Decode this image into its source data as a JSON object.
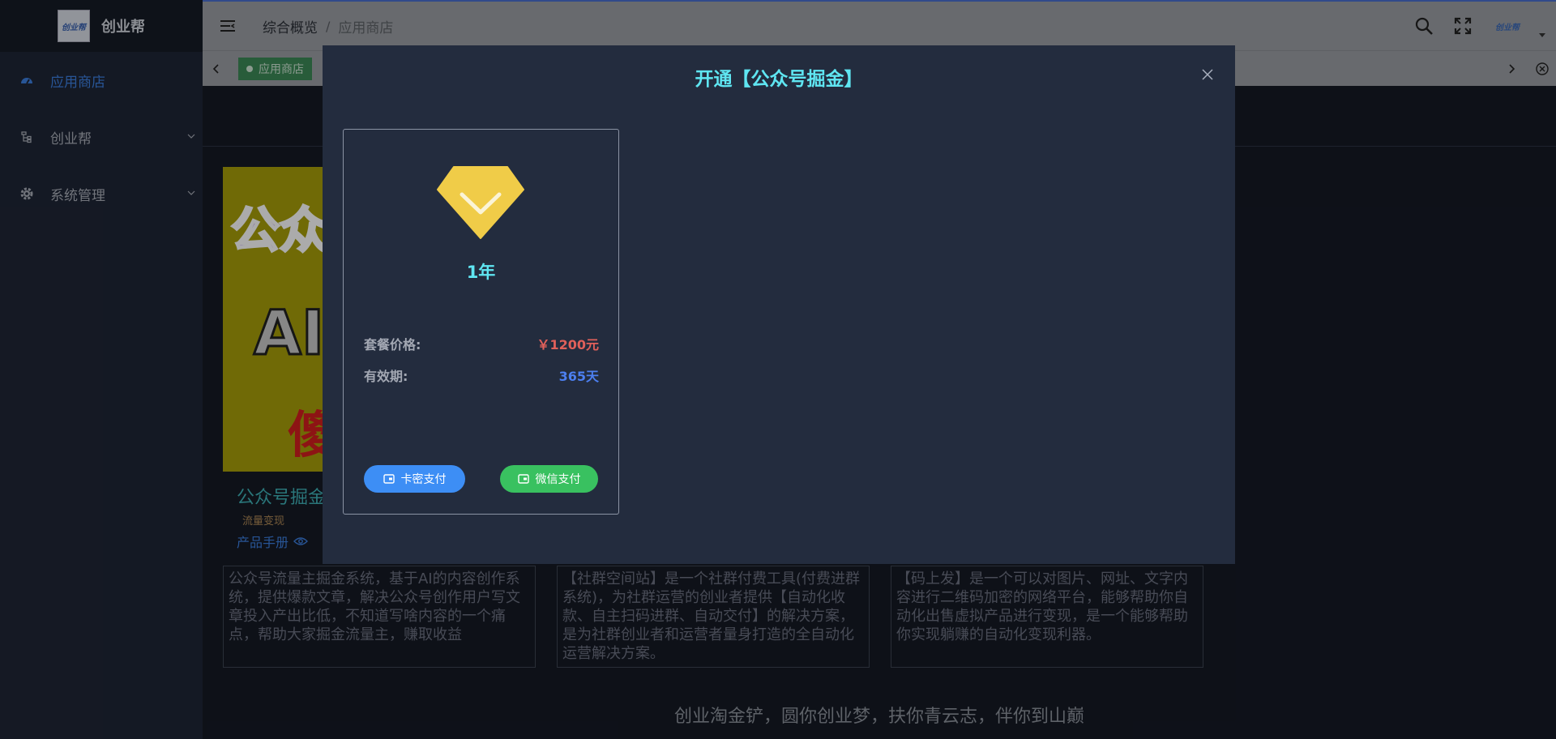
{
  "sidebar": {
    "logo_text": "创业帮",
    "logo_mark": "创业帮",
    "items": [
      {
        "label": "应用商店"
      },
      {
        "label": "创业帮"
      },
      {
        "label": "系统管理"
      }
    ]
  },
  "header": {
    "breadcrumb": [
      "综合概览",
      "应用商店"
    ],
    "separator": "/",
    "avatar_mark": "创业帮"
  },
  "tagbar": {
    "active_tag": "应用商店"
  },
  "content": {
    "card1": {
      "img_line1": "公众号",
      "img_line2": "AI",
      "img_line3": "傻",
      "title": "公众号掘金",
      "tag": "流量变现",
      "manual": "产品手册"
    },
    "descriptions": [
      "公众号流量主掘金系统，基于AI的内容创作系统，提供爆款文章，解决公众号创作用户写文章投入产出比低，不知道写啥内容的一个痛点，帮助大家掘金流量主，赚取收益",
      "【社群空间站】是一个社群付费工具(付费进群系统)，为社群运营的创业者提供【自动化收款、自主扫码进群、自动交付】的解决方案，是为社群创业者和运营者量身打造的全自动化运营解决方案。",
      "【码上发】是一个可以对图片、网址、文字内容进行二维码加密的网络平台，能够帮助你自动化出售虚拟产品进行变现，是一个能够帮助你实现躺赚的自动化变现利器。"
    ],
    "footer": "创业淘金铲，圆你创业梦，扶你青云志，伴你到山巅"
  },
  "modal": {
    "title": "开通【公众号掘金】",
    "plan": {
      "name": "1年",
      "price_label": "套餐价格:",
      "price_value": "￥1200元",
      "validity_label": "有效期:",
      "validity_value": "365天",
      "pay_card_label": "卡密支付",
      "pay_wechat_label": "微信支付"
    }
  },
  "colors": {
    "accent_blue": "#3d7fe0",
    "title_cyan": "#5fe6f2",
    "price_red": "#e0605a",
    "days_blue": "#4c7ff0",
    "pay_card": "#3d8ef5",
    "pay_wechat": "#39c160",
    "gem_yellow": "#f0cc48"
  },
  "icons": [
    "dashboard-icon",
    "tree-icon",
    "gear-icon",
    "hamburger-icon",
    "search-icon",
    "fullscreen-icon",
    "close-icon",
    "eye-icon",
    "diamond-icon",
    "wallet-icon"
  ]
}
